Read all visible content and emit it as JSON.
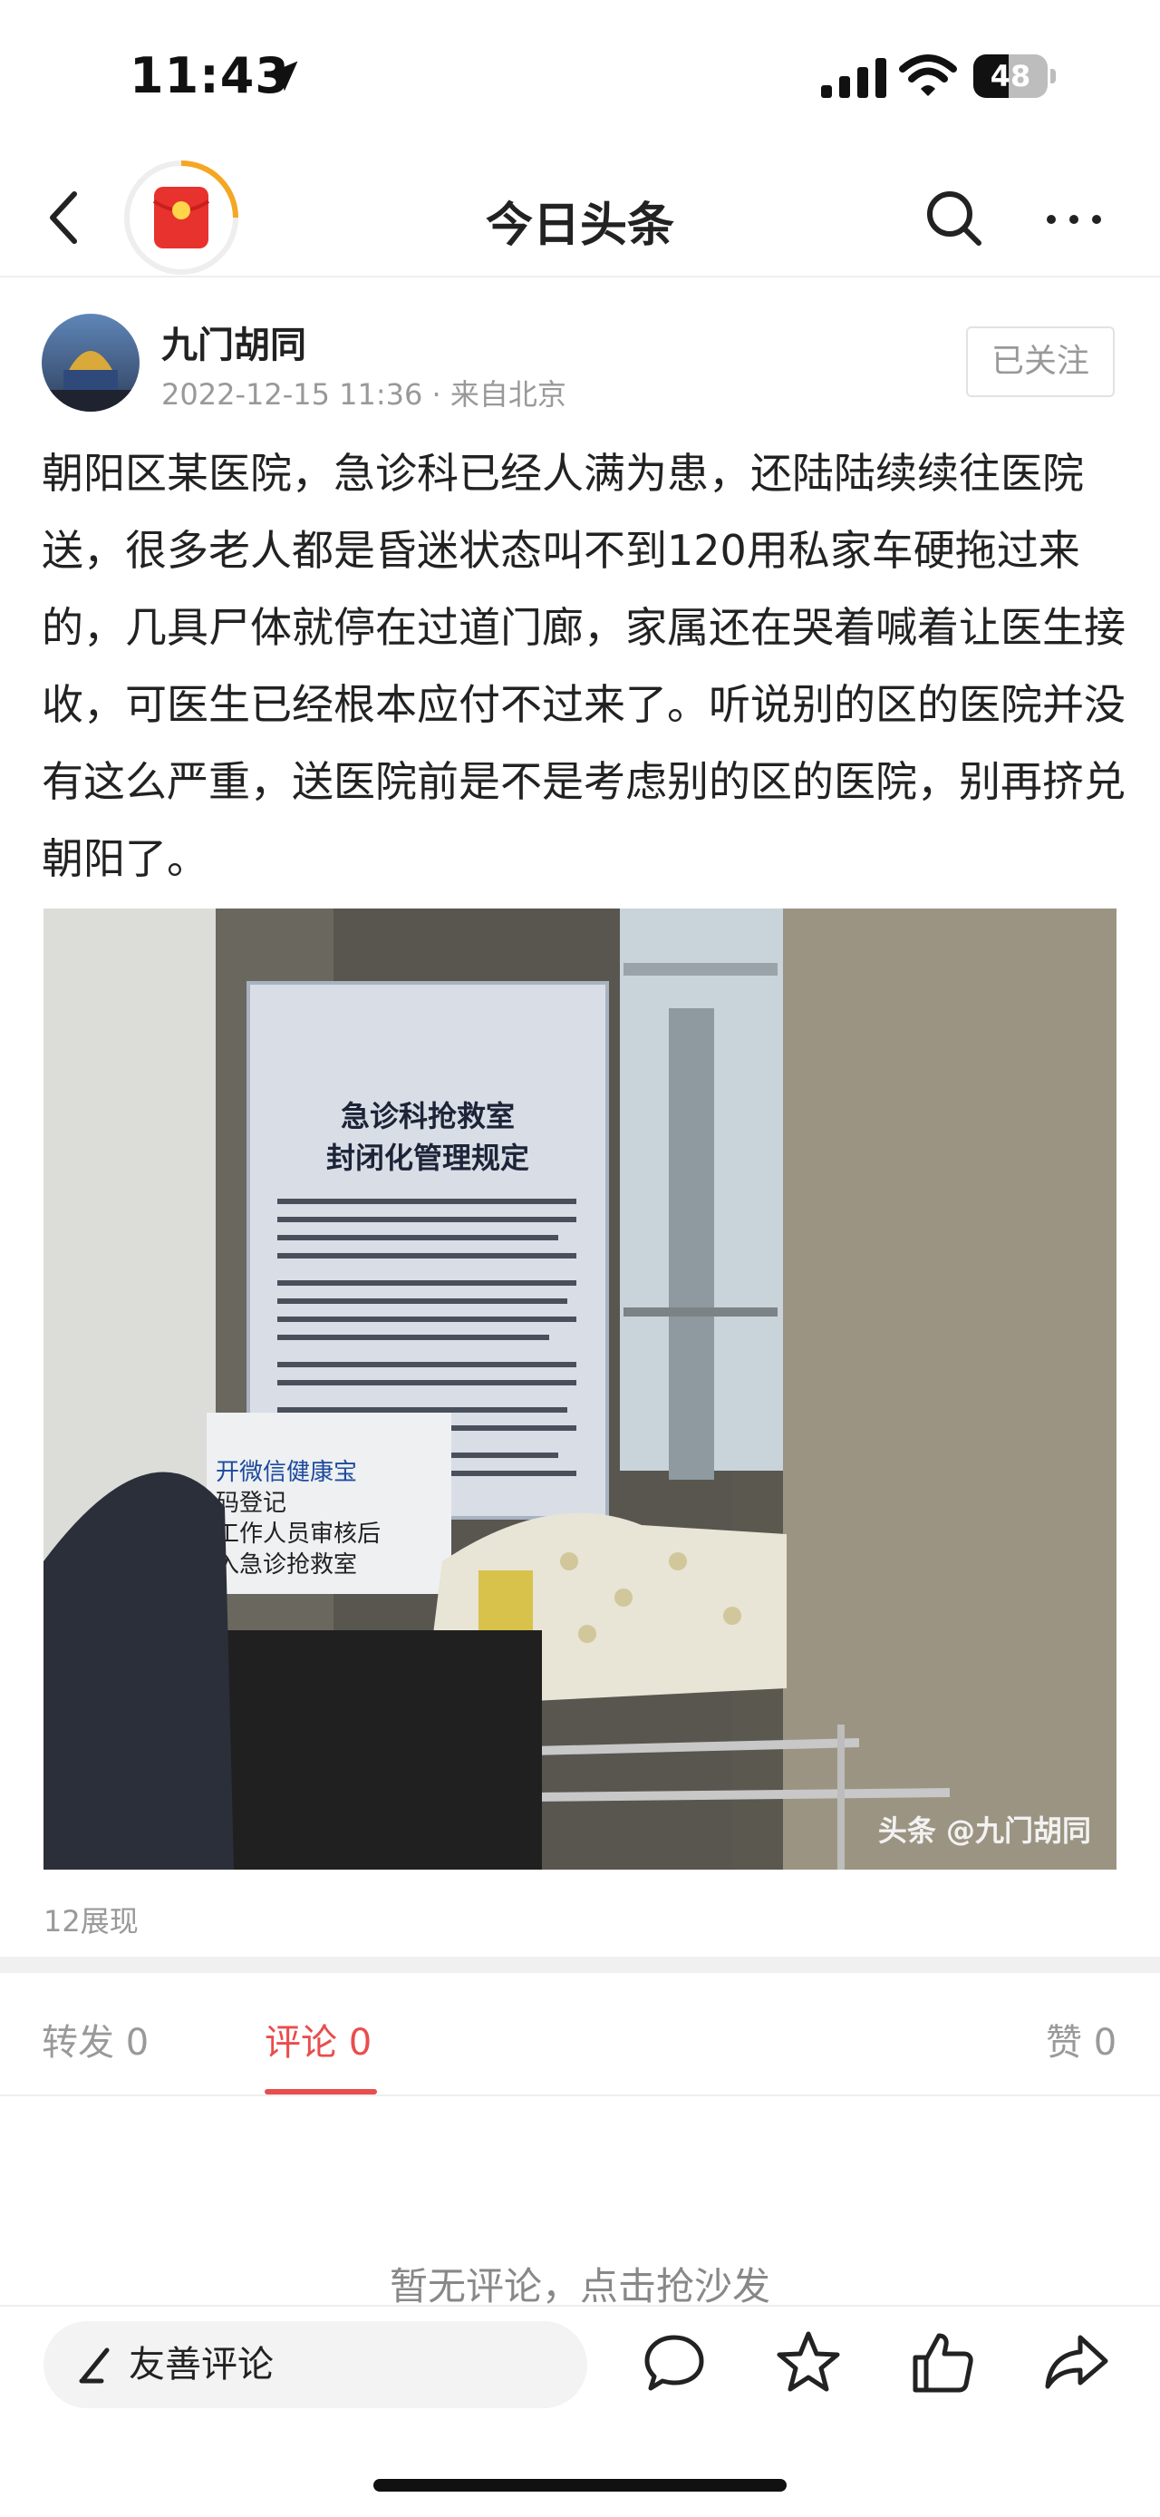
{
  "status_bar": {
    "time": "11:43",
    "battery": "48",
    "battery_level": 0.48
  },
  "nav": {
    "title": "今日头条"
  },
  "post": {
    "author": "九门胡同",
    "meta": "2022-12-15 11:36 · 来自北京",
    "follow_label": "已关注",
    "body": "朝阳区某医院，急诊科已经人满为患，还陆陆续续往医院送，很多老人都是昏迷状态叫不到120用私家车硬拖过来的，几具尸体就停在过道门廊，家属还在哭着喊着让医生接收，可医生已经根本应付不过来了。听说别的区的医院并没有这么严重，送医院前是不是考虑别的区的医院，别再挤兑朝阳了。",
    "image": {
      "sign_title_1": "急诊科抢救室",
      "sign_title_2": "封闭化管理规定",
      "side_sign_1": "开微信健康宝",
      "side_sign_2": "码登记",
      "side_sign_3": "工作人员审核后",
      "side_sign_4": "入急诊抢救室",
      "watermark": "头条 @九门胡同"
    },
    "views": "12展现"
  },
  "tabs": [
    {
      "label": "转发 0"
    },
    {
      "label": "评论 0"
    },
    {
      "label": "赞 0"
    }
  ],
  "active_tab": "评论 0",
  "comments": {
    "empty_hint": "暂无评论，点击抢沙发"
  },
  "bottom_bar": {
    "comment_placeholder": "友善评论"
  },
  "colors": {
    "accent": "#e94d4d",
    "muted": "#999999"
  },
  "icons": [
    "location-arrow-icon",
    "signal-icon",
    "wifi-icon",
    "battery-icon",
    "back-icon",
    "red-packet-icon",
    "search-icon",
    "more-icon",
    "pen-icon",
    "comment-icon",
    "star-icon",
    "like-icon",
    "share-icon"
  ]
}
